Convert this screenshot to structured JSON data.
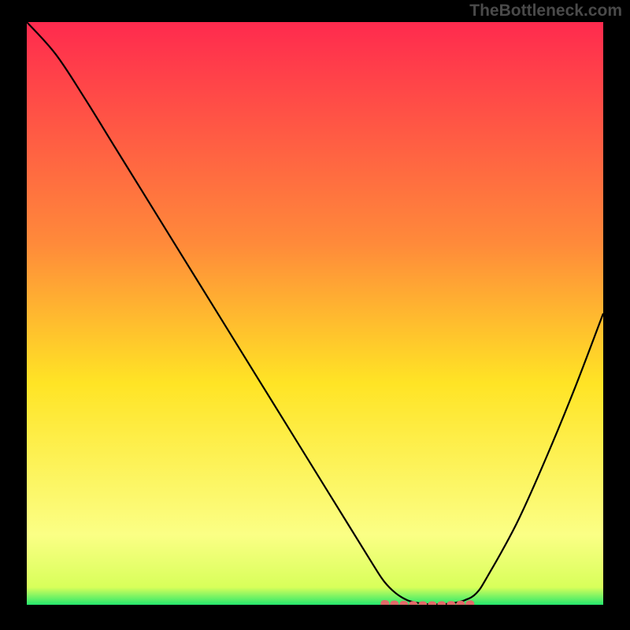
{
  "watermark": "TheBottleneck.com",
  "colors": {
    "frame": "#000000",
    "curve": "#000000",
    "highlight": "#e26a6a",
    "grad_top": "#ff2a4e",
    "grad_mid": "#ffe425",
    "grad_low": "#fbff85",
    "grad_bot": "#25e86d"
  },
  "chart_data": {
    "type": "line",
    "title": "",
    "xlabel": "",
    "ylabel": "",
    "xlim": [
      0,
      100
    ],
    "ylim": [
      0,
      100
    ],
    "x": [
      0,
      5,
      10,
      15,
      20,
      25,
      30,
      35,
      40,
      45,
      50,
      55,
      60,
      62,
      64,
      66,
      68,
      70,
      72,
      74,
      76,
      78,
      80,
      85,
      90,
      95,
      100
    ],
    "y": [
      100,
      94.5,
      87,
      79,
      71,
      63,
      55,
      47,
      39,
      31,
      23,
      15,
      7,
      4,
      2,
      0.8,
      0.3,
      0.1,
      0.1,
      0.3,
      0.8,
      2,
      5,
      14,
      25,
      37,
      50
    ],
    "highlight": {
      "x_range": [
        62,
        78
      ],
      "y": 0.2
    },
    "grid": false,
    "legend": false
  }
}
